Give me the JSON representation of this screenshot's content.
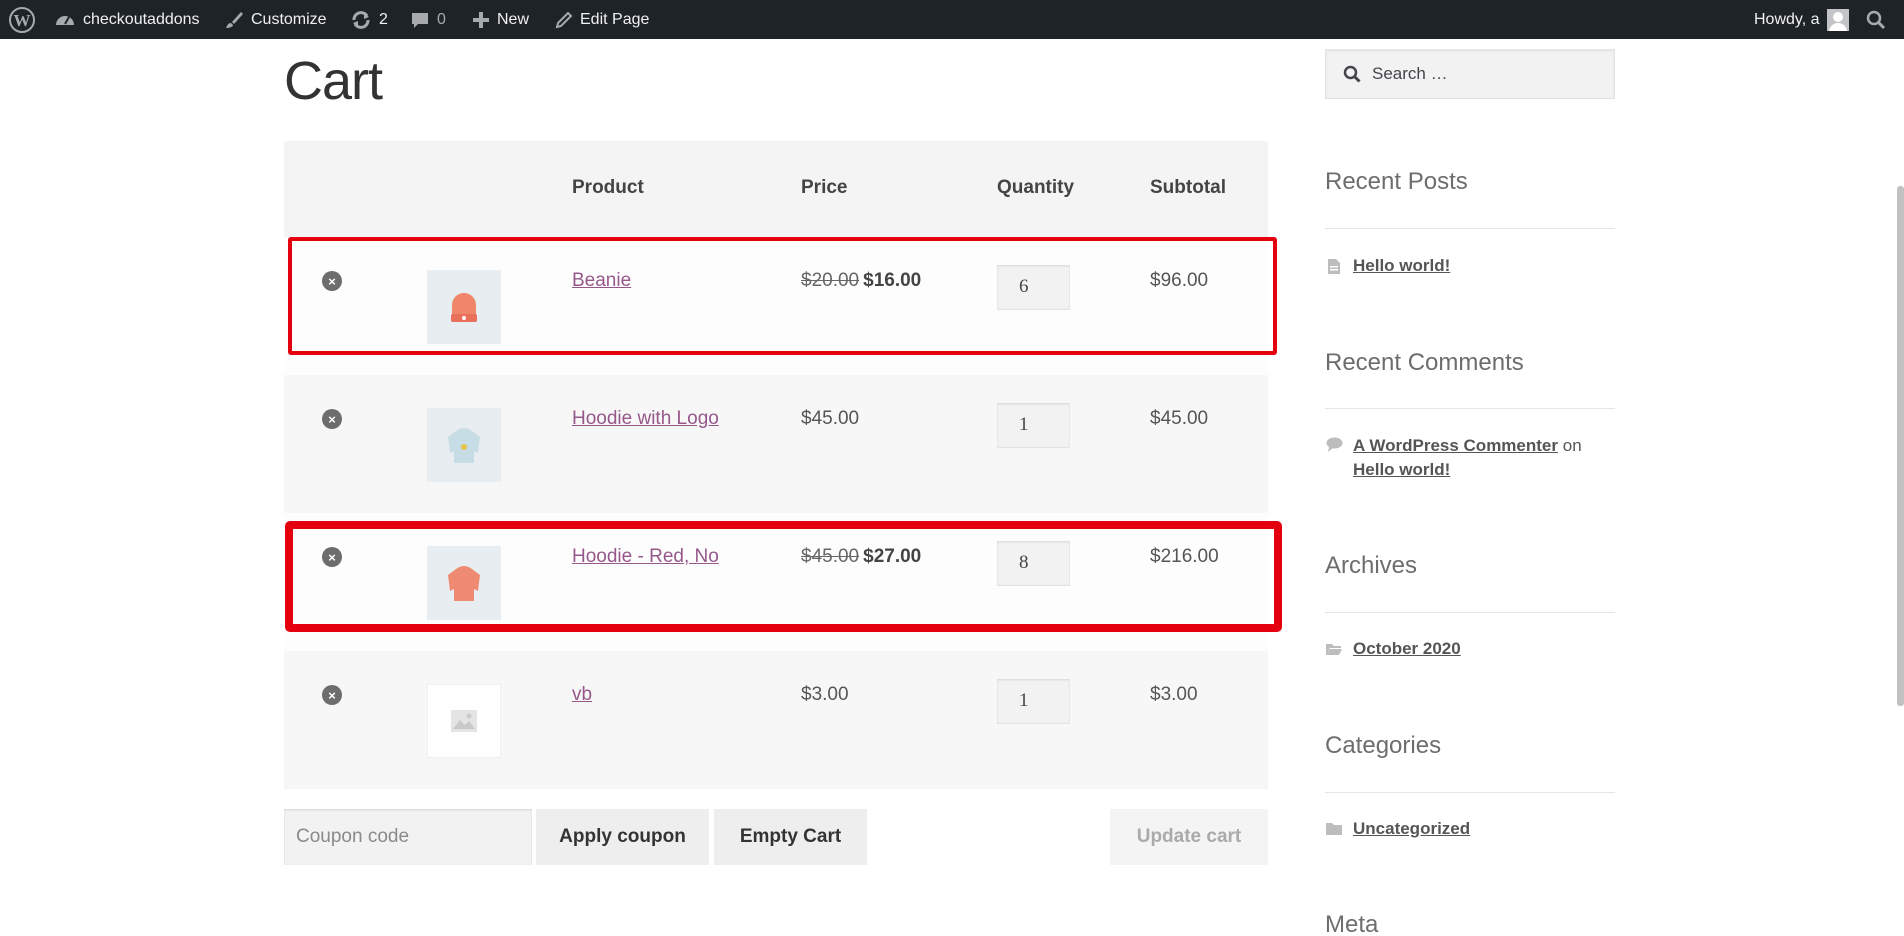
{
  "adminbar": {
    "site_name": "checkoutaddons",
    "customize_label": "Customize",
    "updates_count": "2",
    "comments_count": "0",
    "new_label": "New",
    "edit_label": "Edit Page",
    "howdy_label": "Howdy, a"
  },
  "page": {
    "title": "Cart"
  },
  "cart": {
    "headers": {
      "product": "Product",
      "price": "Price",
      "quantity": "Quantity",
      "subtotal": "Subtotal"
    },
    "items": [
      {
        "name": "Beanie",
        "regular_price": "$20.00",
        "sale_price": "$16.00",
        "quantity": "6",
        "subtotal": "$96.00",
        "thumb": "beanie"
      },
      {
        "name": "Hoodie with Logo",
        "price": "$45.00",
        "quantity": "1",
        "subtotal": "$45.00",
        "thumb": "hoodie-logo"
      },
      {
        "name": "Hoodie - Red, No",
        "regular_price": "$45.00",
        "sale_price": "$27.00",
        "quantity": "8",
        "subtotal": "$216.00",
        "thumb": "hoodie-red"
      },
      {
        "name": "vb",
        "price": "$3.00",
        "quantity": "1",
        "subtotal": "$3.00",
        "thumb": "placeholder"
      }
    ],
    "remove_symbol": "×",
    "coupon_placeholder": "Coupon code",
    "apply_coupon_label": "Apply coupon",
    "empty_cart_label": "Empty Cart",
    "update_cart_label": "Update cart"
  },
  "sidebar": {
    "search_placeholder": "Search …",
    "recent_posts_title": "Recent Posts",
    "recent_posts": [
      "Hello world!"
    ],
    "recent_comments_title": "Recent Comments",
    "recent_comment": {
      "author": "A WordPress Commenter",
      "on": "on",
      "post": "Hello world!"
    },
    "archives_title": "Archives",
    "archives": [
      "October 2020"
    ],
    "categories_title": "Categories",
    "categories": [
      "Uncategorized"
    ],
    "meta_title": "Meta"
  },
  "colors": {
    "highlight": "#e4000f",
    "link": "#96588a",
    "adminbar": "#1d2327"
  }
}
